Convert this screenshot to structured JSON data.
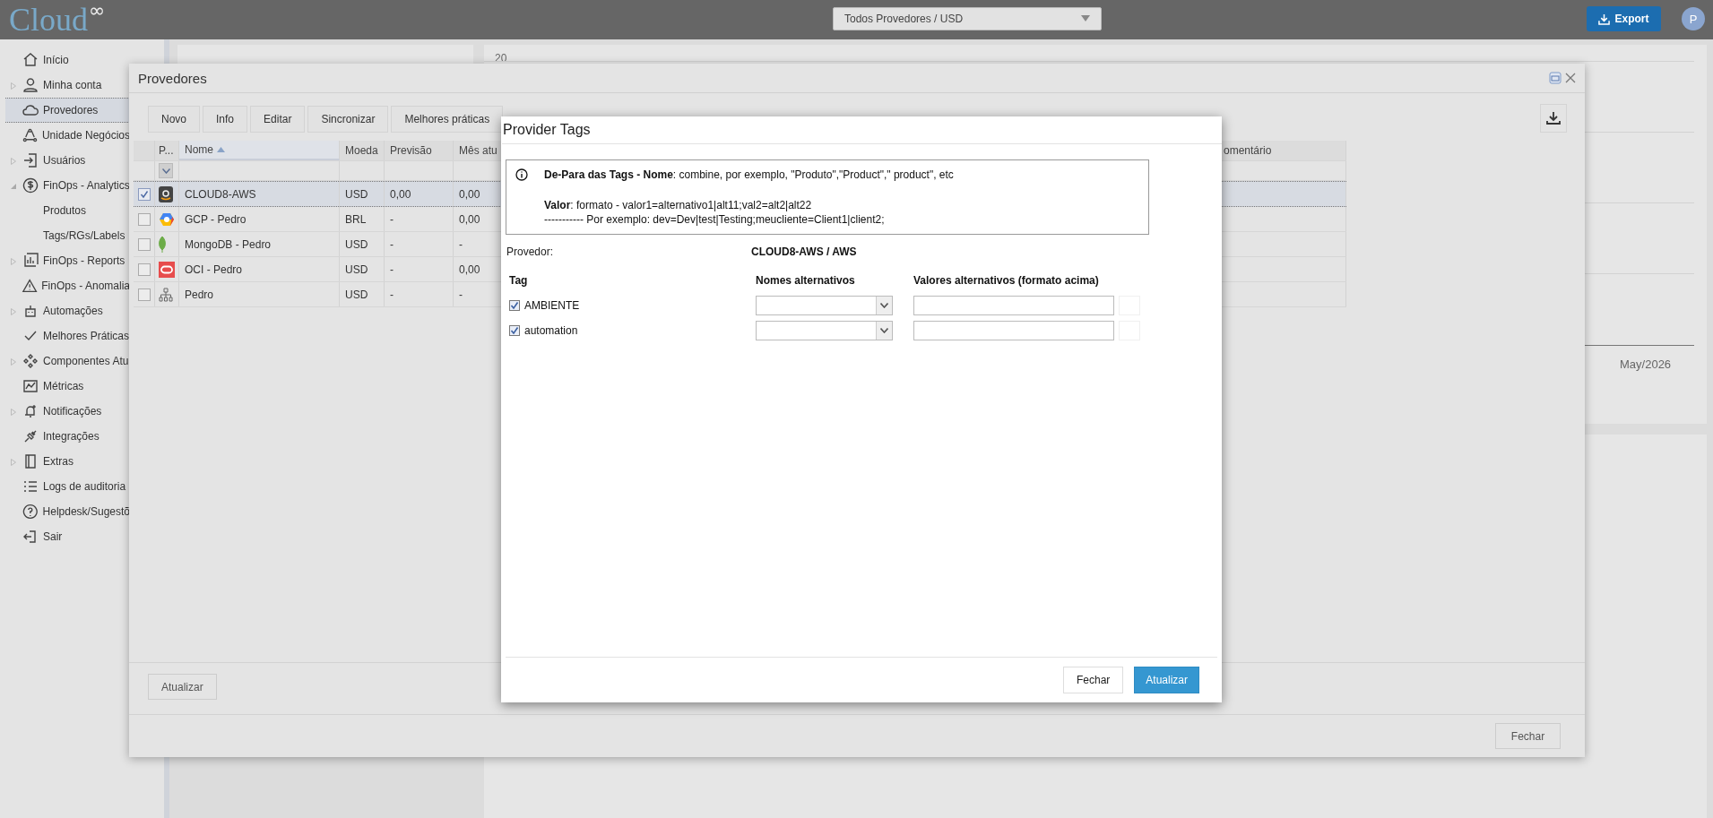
{
  "top_bar": {
    "logo": "Cloud",
    "logo_mark": "∞",
    "provider_select": "Todos Provedores / USD",
    "export_button": "Export",
    "avatar": "P"
  },
  "sidebar": {
    "items": [
      {
        "label": "Início",
        "selected": false
      },
      {
        "label": "Minha conta",
        "selected": false,
        "expanded": false
      },
      {
        "label": "Provedores",
        "selected": true
      },
      {
        "label": "Unidade Negócios",
        "selected": false
      },
      {
        "label": "Usuários",
        "selected": false,
        "expanded": false
      },
      {
        "label": "FinOps - Analytics",
        "selected": false,
        "expanded": true,
        "children": [
          {
            "label": "Produtos",
            "selected": false
          },
          {
            "label": "Tags/RGs/Labels",
            "selected": false
          }
        ]
      },
      {
        "label": "FinOps - Reports",
        "selected": false,
        "expanded": false
      },
      {
        "label": "FinOps - Anomalia",
        "selected": false
      },
      {
        "label": "Automações",
        "selected": false,
        "expanded": false
      },
      {
        "label": "Melhores Práticas",
        "selected": false
      },
      {
        "label": "Componentes Atu",
        "selected": false,
        "expanded": false
      },
      {
        "label": "Métricas",
        "selected": false
      },
      {
        "label": "Notificações",
        "selected": false,
        "expanded": false
      },
      {
        "label": "Integrações",
        "selected": false
      },
      {
        "label": "Extras",
        "selected": false,
        "expanded": false
      },
      {
        "label": "Logs de auditoria",
        "selected": false
      },
      {
        "label": "Helpdesk/Sugestõ",
        "selected": false
      },
      {
        "label": "Sair",
        "selected": false
      }
    ]
  },
  "background": {
    "chart_tick": "20",
    "chart_period": "May/2026"
  },
  "providers_window": {
    "title": "Provedores",
    "toolbar": [
      "Novo",
      "Info",
      "Editar",
      "Sincronizar",
      "Melhores práticas"
    ],
    "table": {
      "columns": [
        {
          "label": "P...",
          "sorted": false
        },
        {
          "label": "Nome",
          "sorted": true
        },
        {
          "label": "Moeda",
          "sorted": false
        },
        {
          "label": "Previsão",
          "sorted": false
        },
        {
          "label": "Mês atu",
          "sorted": false
        },
        {
          "label": "omentário",
          "sorted": false
        }
      ],
      "rows": [
        {
          "kind": "aws",
          "name": "CLOUD8-AWS",
          "currency": "USD",
          "forecast": "0,00",
          "current_month": "0,00",
          "checked": true,
          "selected": true
        },
        {
          "kind": "gcp",
          "name": "GCP - Pedro",
          "currency": "BRL",
          "forecast": "-",
          "current_month": "0,00",
          "checked": false,
          "selected": false
        },
        {
          "kind": "mongodb",
          "name": "MongoDB - Pedro",
          "currency": "USD",
          "forecast": "-",
          "current_month": "-",
          "checked": false,
          "selected": false
        },
        {
          "kind": "oci",
          "name": "OCI - Pedro",
          "currency": "USD",
          "forecast": "-",
          "current_month": "0,00",
          "checked": false,
          "selected": false
        },
        {
          "kind": "group",
          "name": "Pedro",
          "currency": "USD",
          "forecast": "-",
          "current_month": "-",
          "checked": false,
          "selected": false
        }
      ]
    },
    "refresh_button": "Atualizar",
    "close_button": "Fechar"
  },
  "provider_tags_dialog": {
    "title": "Provider Tags",
    "info": [
      "**De-Para das Tags - Nome**: combine, por exemplo, \"Produto\",\"Product\",\" product\", etc",
      "**Valor**: formato - valor1=alternativo1|alt11;val2=alt2|alt22",
      "----------- Por exemplo: dev=Dev|test|Testing;meucliente=Client1|client2;"
    ],
    "provider_label": "Provedor:",
    "provider_value": "CLOUD8-AWS / AWS",
    "columns": [
      "Tag",
      "Nomes alternativos",
      "Valores alternativos (formato acima)"
    ],
    "tags": [
      {
        "name": "AMBIENTE",
        "checked": true
      },
      {
        "name": "automation",
        "checked": true
      }
    ],
    "buttons": [
      {
        "label": "Fechar",
        "primary": false
      },
      {
        "label": "Atualizar",
        "primary": true
      }
    ]
  }
}
